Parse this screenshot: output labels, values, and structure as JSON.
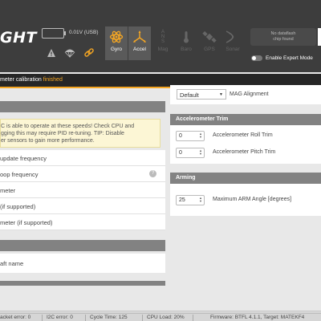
{
  "app": {
    "logo_text": "GHT"
  },
  "header": {
    "battery_text": "0.01V (USB)",
    "sensors": [
      {
        "label": "Gyro",
        "state": "active"
      },
      {
        "label": "Accel",
        "state": "active"
      },
      {
        "label": "Mag",
        "state": "inactive"
      },
      {
        "label": "Baro",
        "state": "inactive"
      },
      {
        "label": "GPS",
        "state": "inactive"
      },
      {
        "label": "Sonar",
        "state": "inactive"
      }
    ],
    "dataflash_line1": "No dataflash",
    "dataflash_line2": "chip found",
    "expert_mode_label": "Enable Expert Mode"
  },
  "calibration": {
    "prefix": "meter calibration ",
    "status": "finished"
  },
  "left_panel": {
    "note_lines": [
      "C is able to operate at these speeds! Check CPU and",
      "gging this may require PID re-tuning. TIP: Disable",
      "er sensors to gain more performance."
    ],
    "rows": [
      "update frequency",
      "oop frequency",
      "meter",
      "(if supported)",
      "meter (if supported)"
    ],
    "craft_name_label": "aft name"
  },
  "right_panel": {
    "mag_alignment_value": "Default",
    "mag_alignment_label": "MAG Alignment",
    "accel_trim_title": "Accelerometer Trim",
    "roll_trim_value": "0",
    "roll_trim_label": "Accelerometer Roll Trim",
    "pitch_trim_value": "0",
    "pitch_trim_label": "Accelerometer Pitch Trim",
    "arming_title": "Arming",
    "arm_angle_value": "25",
    "arm_angle_label": "Maximum ARM Angle [degrees]"
  },
  "status_bar": {
    "packet_error": "acket error: 0",
    "i2c_error": "I2C error: 0",
    "cycle_time": "Cycle Time: 125",
    "cpu_load": "CPU Load: 20%",
    "firmware": "Firmware: BTFL 4.1.1, Target: MATEKF4"
  },
  "colors": {
    "header_bg": "#3d3d3d",
    "accent": "#f5a623",
    "section_header": "#828282",
    "note_bg": "#fcf6d5"
  }
}
